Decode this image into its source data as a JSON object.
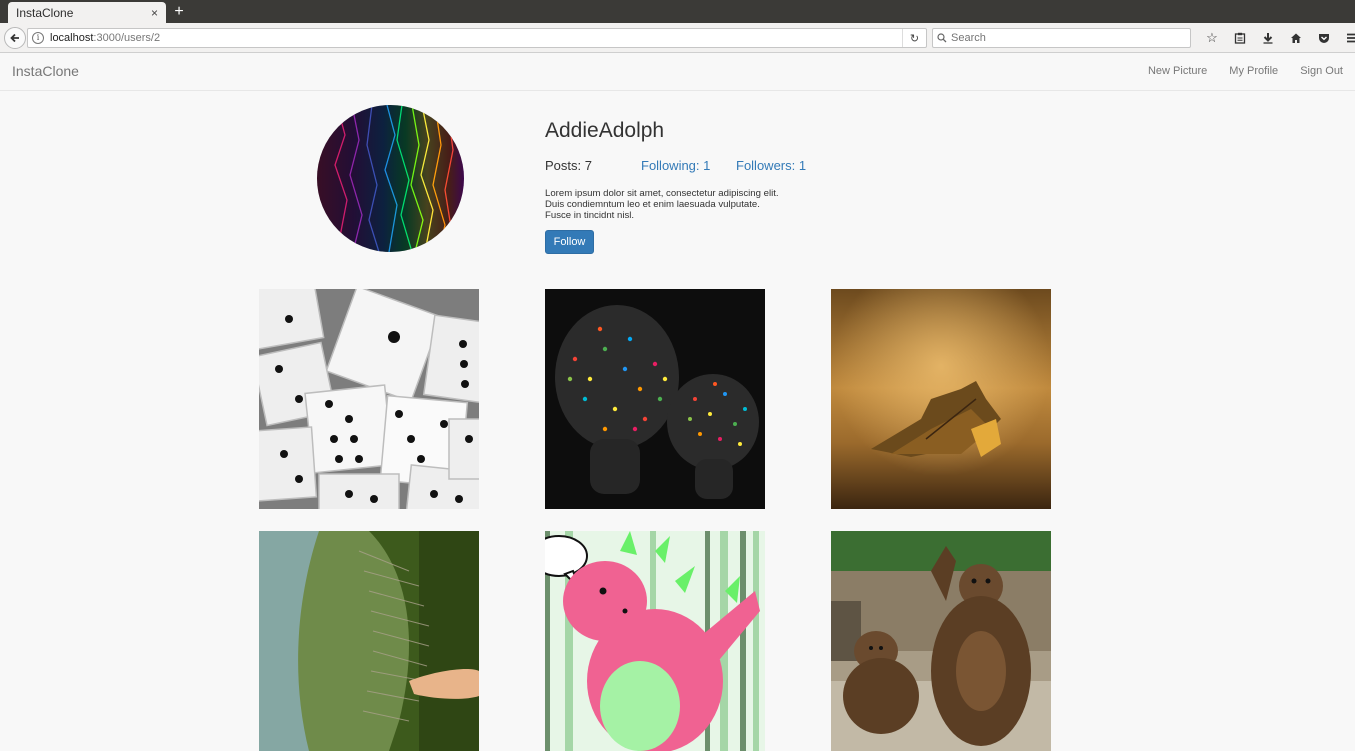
{
  "browser": {
    "tab_title": "InstaClone",
    "tab_close": "×",
    "new_tab": "+",
    "url_host": "localhost",
    "url_path": ":3000/users/2",
    "search_placeholder": "Search",
    "toolbar_icons": [
      "star-icon",
      "clipboard-icon",
      "download-icon",
      "home-icon",
      "pocket-icon",
      "menu-icon"
    ]
  },
  "navbar": {
    "brand": "InstaClone",
    "links": [
      "New Picture",
      "My Profile",
      "Sign Out"
    ]
  },
  "profile": {
    "username": "AddieAdolph",
    "posts": "Posts: 7",
    "following": "Following: 1",
    "followers": "Followers: 1",
    "bio_lines": [
      "Lorem ipsum dolor sit amet, consectetur adipiscing elit.",
      "Duis condiemntum leo et enim laesuada vulputate.",
      "Fusce in tincidnt nisl."
    ],
    "follow_label": "Follow"
  },
  "pictures": [
    {
      "name": "dice"
    },
    {
      "name": "lamps"
    },
    {
      "name": "leaf"
    },
    {
      "name": "bubble"
    },
    {
      "name": "dragon"
    },
    {
      "name": "bears"
    }
  ],
  "colors": {
    "accent": "#337ab7",
    "navbar_bg": "#f8f8f8",
    "browser_tabstrip": "#3b3a37"
  }
}
